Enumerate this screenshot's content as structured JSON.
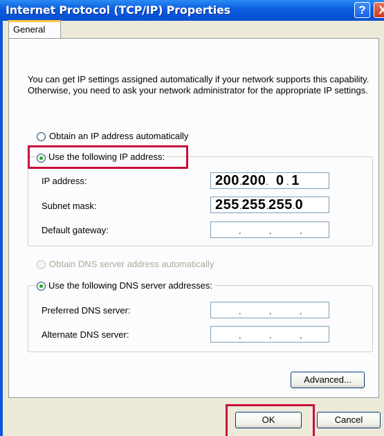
{
  "window": {
    "title": "Internet Protocol (TCP/IP) Properties"
  },
  "titlebar": {
    "help_glyph": "?",
    "close_glyph": "X"
  },
  "tabs": [
    {
      "label": "General"
    }
  ],
  "description": "You can get IP settings assigned automatically if your network supports this capability. Otherwise, you need to ask your network administrator for the appropriate IP settings.",
  "ip": {
    "auto_label": "Obtain an IP address automatically",
    "manual_label": "Use the following IP address:",
    "selected": "manual",
    "fields": [
      {
        "label": "IP address:",
        "octets": [
          "200",
          "200",
          "0",
          "1"
        ]
      },
      {
        "label": "Subnet mask:",
        "octets": [
          "255",
          "255",
          "255",
          "0"
        ]
      },
      {
        "label": "Default gateway:",
        "octets": [
          "",
          "",
          "",
          ""
        ]
      }
    ]
  },
  "dns": {
    "auto_label": "Obtain DNS server address automatically",
    "auto_enabled": false,
    "manual_label": "Use the following DNS server addresses:",
    "selected": "manual",
    "fields": [
      {
        "label": "Preferred DNS server:",
        "octets": [
          "",
          "",
          "",
          ""
        ]
      },
      {
        "label": "Alternate DNS server:",
        "octets": [
          "",
          "",
          "",
          ""
        ]
      }
    ]
  },
  "buttons": {
    "advanced": "Advanced...",
    "ok": "OK",
    "cancel": "Cancel"
  },
  "colors": {
    "highlight": "#C8103B",
    "title_bar": "#0B5CE0",
    "dialog_bg": "#ECE9D8"
  }
}
